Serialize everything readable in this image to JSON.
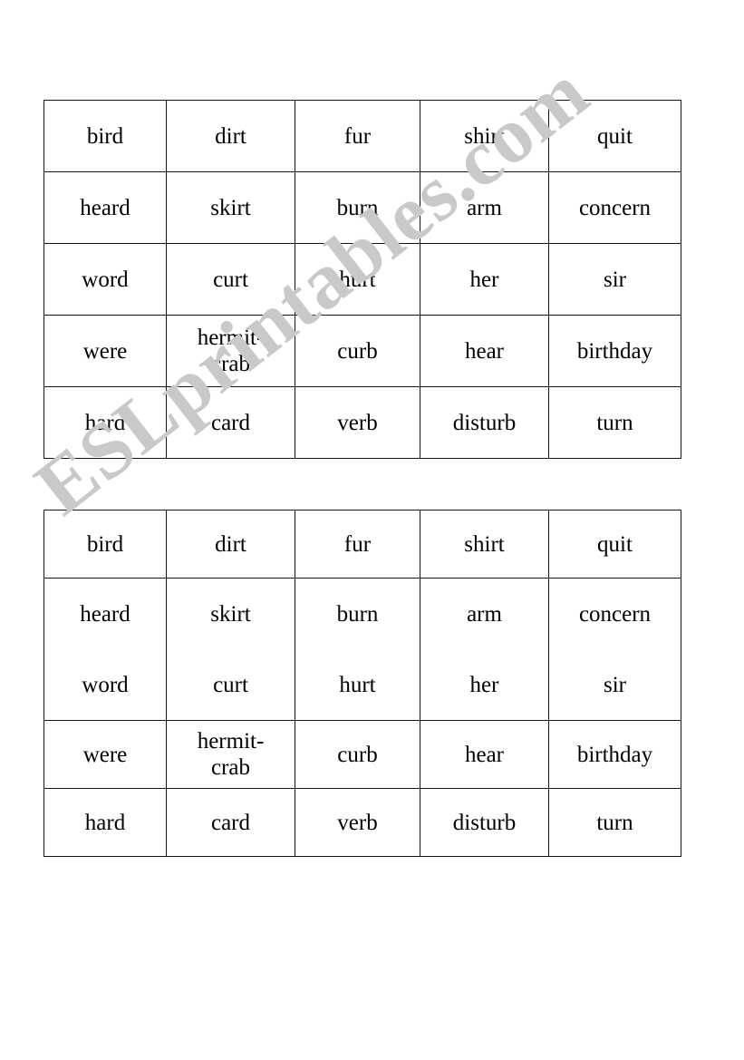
{
  "document": {
    "kind": "word-grid-worksheet",
    "background_color": "#ffffff",
    "border_color": "#141414",
    "text_color": "#000000"
  },
  "watermark": {
    "text": "ESLprintables.com",
    "color": "#c9c9c9",
    "rotation_degrees": -38
  },
  "grids": [
    {
      "id": "grid-one",
      "columns": 5,
      "rows": 5,
      "cells": [
        [
          "bird",
          "dirt",
          "fur",
          "shirt",
          "quit"
        ],
        [
          "heard",
          "skirt",
          "burn",
          "arm",
          "concern"
        ],
        [
          "word",
          "curt",
          "hurt",
          "her",
          "sir"
        ],
        [
          "were",
          "hermit-crab",
          "curb",
          "hear",
          "birthday"
        ],
        [
          "hard",
          "card",
          "verb",
          "disturb",
          "turn"
        ]
      ]
    },
    {
      "id": "grid-two",
      "columns": 5,
      "rows": 4,
      "note": "second and third word rows share one merged cell with no divider",
      "cells": [
        [
          "bird",
          "dirt",
          "fur",
          "shirt",
          "quit"
        ],
        [
          "heard",
          "skirt",
          "burn",
          "arm",
          "concern"
        ],
        [
          "word",
          "curt",
          "hurt",
          "her",
          "sir"
        ],
        [
          "were",
          "hermit-crab",
          "curb",
          "hear",
          "birthday"
        ],
        [
          "hard",
          "card",
          "verb",
          "disturb",
          "turn"
        ]
      ]
    }
  ]
}
